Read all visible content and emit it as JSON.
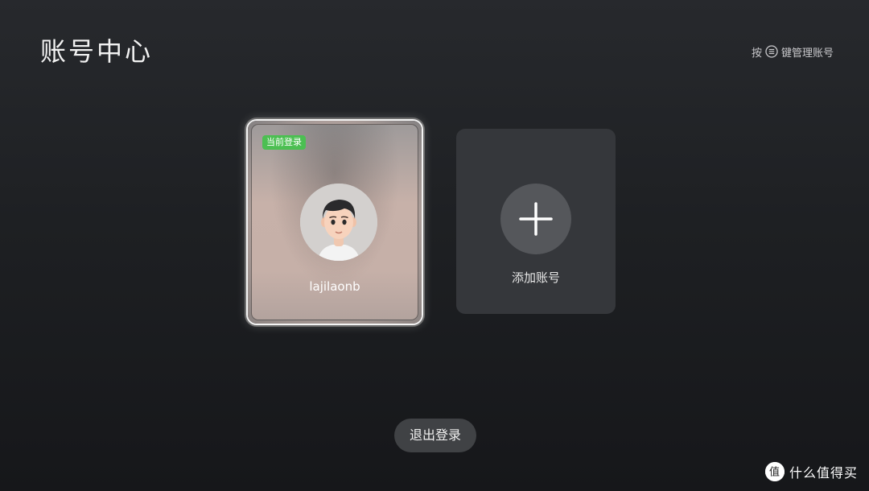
{
  "header": {
    "title": "账号中心",
    "hint_prefix": "按",
    "hint_suffix": "键管理账号",
    "hint_icon": "menu-key-icon"
  },
  "accounts": {
    "current": {
      "badge": "当前登录",
      "username": "lajilaonb",
      "avatar_icon": "cartoon-avatar-icon"
    },
    "add": {
      "label": "添加账号",
      "icon": "plus-icon"
    }
  },
  "footer": {
    "logout_label": "退出登录"
  },
  "watermark": {
    "text": "什么值得买",
    "logo_glyph": "值"
  },
  "colors": {
    "badge_green": "#4cbf52",
    "focus_border": "#f4f4f4",
    "card_bg": "#35373b",
    "button_bg": "#404245"
  }
}
